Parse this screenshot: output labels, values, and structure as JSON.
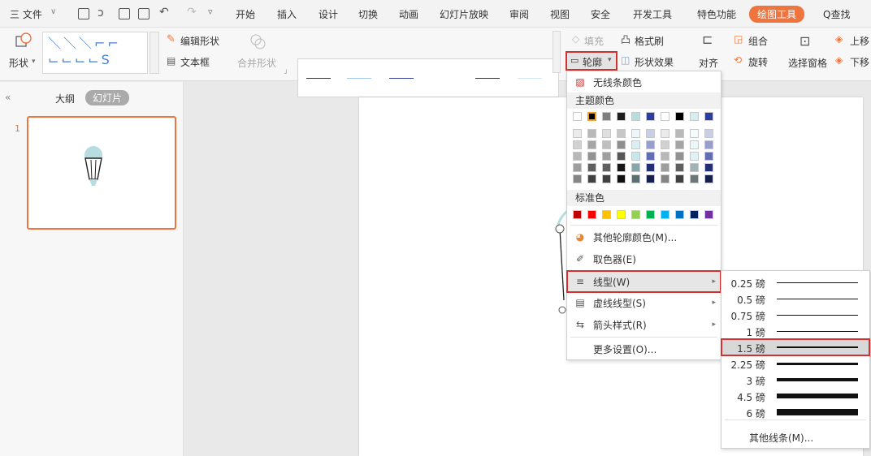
{
  "menubar": {
    "file_menu": "三 文件",
    "tabs": [
      "开始",
      "插入",
      "设计",
      "切换",
      "动画",
      "幻灯片放映",
      "审阅",
      "视图",
      "安全",
      "开发工具",
      "特色功能"
    ],
    "active_tool_tab": "绘图工具",
    "search": "Q查找"
  },
  "ribbon": {
    "shapes_label": "形状",
    "edit_shape": "编辑形状",
    "text_box": "文本框",
    "merge_shape": "合并形状",
    "fill": "填充",
    "format_painter": "格式刷",
    "outline": "轮廓",
    "shape_effect": "形状效果",
    "align": "对齐",
    "group": "组合",
    "rotate": "旋转",
    "selection_pane": "选择窗格",
    "bring_up": "上移",
    "send_down": "下移"
  },
  "panel": {
    "tab_outline": "大纲",
    "tab_slides": "幻灯片",
    "slide_number": "1"
  },
  "outline_menu": {
    "no_line_color": "无线条颜色",
    "theme_colors_title": "主题颜色",
    "standard_colors_title": "标准色",
    "more_colors": "其他轮廓颜色(M)...",
    "eyedropper": "取色器(E)",
    "line_type": "线型(W)",
    "dash_type": "虚线线型(S)",
    "arrow_style": "箭头样式(R)",
    "more_settings": "更多设置(O)...",
    "theme_row_colors": [
      "#ffffff",
      "#000000",
      "#7f7f7f",
      "#1f1f1f",
      "#b7dde0",
      "#2e3d99",
      "#ffffff",
      "#000000",
      "#d6eef0",
      "#2e3d99"
    ],
    "standard_colors": [
      "#c00000",
      "#ff0000",
      "#ffc000",
      "#ffff00",
      "#92d050",
      "#00b050",
      "#00b0f0",
      "#0070c0",
      "#002060",
      "#7030a0"
    ]
  },
  "weight_menu": {
    "weights": [
      {
        "label": "0.25 磅",
        "value": 0.25
      },
      {
        "label": "0.5 磅",
        "value": 0.5
      },
      {
        "label": "0.75 磅",
        "value": 0.75
      },
      {
        "label": "1 磅",
        "value": 1
      },
      {
        "label": "1.5 磅",
        "value": 1.5
      },
      {
        "label": "2.25 磅",
        "value": 2.25
      },
      {
        "label": "3 磅",
        "value": 3
      },
      {
        "label": "4.5 磅",
        "value": 4.5
      },
      {
        "label": "6 磅",
        "value": 6
      }
    ],
    "selected": "1.5 磅",
    "more_lines": "其他线条(M)..."
  }
}
